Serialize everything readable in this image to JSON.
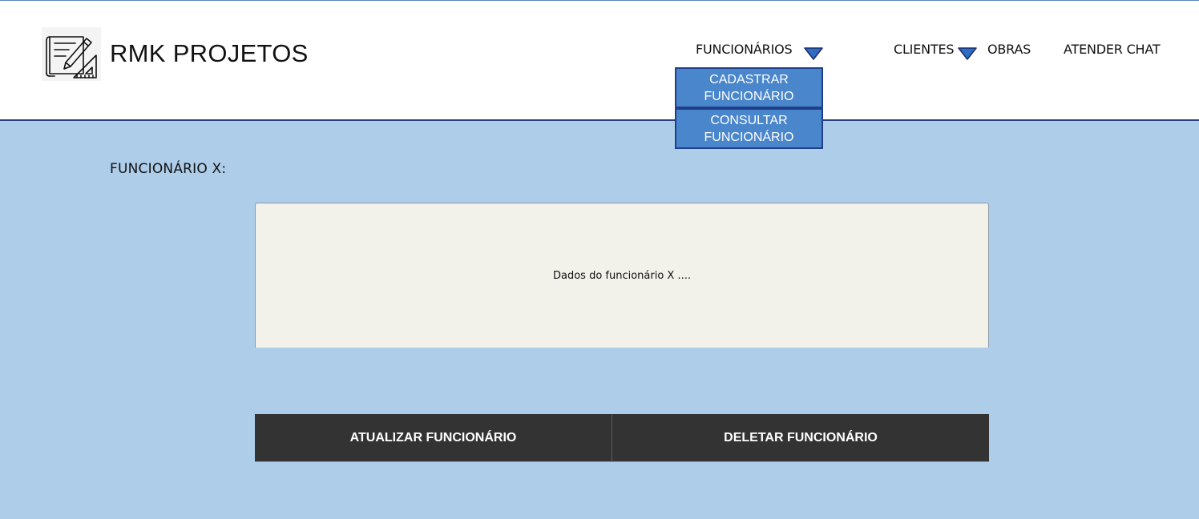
{
  "brand": {
    "name": "RMK PROJETOS",
    "logo_icon": "blueprint-pencil-icon"
  },
  "nav": {
    "funcionarios": "FUNCIONÁRIOS",
    "clientes": "CLIENTES",
    "obras": "OBRAS",
    "atender_chat": "ATENDER CHAT",
    "caret_color": "#2f6cc2"
  },
  "dropdown": {
    "items": [
      {
        "line1": "CADASTRAR",
        "line2": "FUNCIONÁRIO"
      },
      {
        "line1": "CONSULTAR",
        "line2": "FUNCIONÁRIO"
      }
    ]
  },
  "main": {
    "heading": "FUNCIONÁRIO X:",
    "panel_text": "Dados do funcionário X ....",
    "update_button": "ATUALIZAR FUNCIONÁRIO",
    "delete_button": "DELETAR FUNCIONÁRIO"
  },
  "colors": {
    "background": "#aecde9",
    "header": "#ffffff",
    "dropdown": "#4a86cc",
    "button": "#333333",
    "panel": "#f2f1ea"
  }
}
